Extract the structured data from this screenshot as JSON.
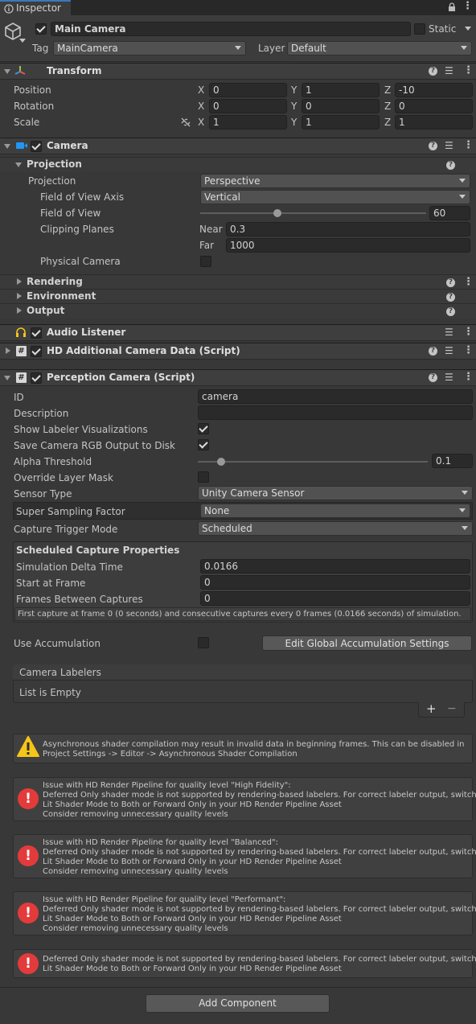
{
  "tab": {
    "title": "Inspector"
  },
  "header": {
    "name": "Main Camera",
    "static_label": "Static",
    "tag_label": "Tag",
    "tag_value": "MainCamera",
    "layer_label": "Layer",
    "layer_value": "Default"
  },
  "transform": {
    "title": "Transform",
    "rows": [
      {
        "label": "Position",
        "x": "0",
        "y": "1",
        "z": "-10"
      },
      {
        "label": "Rotation",
        "x": "0",
        "y": "0",
        "z": "0"
      },
      {
        "label": "Scale",
        "x": "1",
        "y": "1",
        "z": "1"
      }
    ],
    "axis_x": "X",
    "axis_y": "Y",
    "axis_z": "Z"
  },
  "camera": {
    "title": "Camera",
    "projection_section": "Projection",
    "projection_label": "Projection",
    "projection_value": "Perspective",
    "fov_axis_label": "Field of View Axis",
    "fov_axis_value": "Vertical",
    "fov_label": "Field of View",
    "fov_value": "60",
    "fov_fraction": 0.34,
    "clipping_label": "Clipping Planes",
    "near_label": "Near",
    "near_value": "0.3",
    "far_label": "Far",
    "far_value": "1000",
    "physical_label": "Physical Camera",
    "rendering": "Rendering",
    "environment": "Environment",
    "output": "Output"
  },
  "audio_listener": {
    "title": "Audio Listener"
  },
  "hd_additional": {
    "title": "HD Additional Camera Data (Script)"
  },
  "perception": {
    "title": "Perception Camera (Script)",
    "id_label": "ID",
    "id_value": "camera",
    "description_label": "Description",
    "description_value": "",
    "show_labeler_label": "Show Labeler Visualizations",
    "save_rgb_label": "Save Camera RGB Output to Disk",
    "alpha_label": "Alpha Threshold",
    "alpha_value": "0.1",
    "alpha_fraction": 0.1,
    "override_mask_label": "Override Layer Mask",
    "sensor_type_label": "Sensor Type",
    "sensor_type_value": "Unity Camera Sensor",
    "super_sampling_label": "Super Sampling Factor",
    "super_sampling_value": "None",
    "capture_trigger_label": "Capture Trigger Mode",
    "capture_trigger_value": "Scheduled",
    "scheduled_title": "Scheduled Capture Properties",
    "sim_delta_label": "Simulation Delta Time",
    "sim_delta_value": "0.0166",
    "start_frame_label": "Start at Frame",
    "start_frame_value": "0",
    "frames_between_label": "Frames Between Captures",
    "frames_between_value": "0",
    "capture_note": "First capture at frame 0 (0 seconds) and consecutive captures every 0 frames (0.0166 seconds) of simulation.",
    "use_accum_label": "Use Accumulation",
    "edit_accum_button": "Edit Global Accumulation Settings",
    "labelers_title": "Camera Labelers",
    "labelers_empty": "List is Empty",
    "add_glyph": "+",
    "remove_glyph": "−"
  },
  "messages": [
    {
      "type": "warning",
      "lines": [
        "Asynchronous shader compilation may result in invalid data in beginning frames. This can be disabled in",
        "Project Settings -> Editor -> Asynchronous Shader Compilation"
      ]
    },
    {
      "type": "error",
      "lines": [
        "Issue with HD Render Pipeline for quality level \"High Fidelity\":",
        "Deferred Only shader mode is not supported by rendering-based labelers. For correct labeler output, switch",
        "Lit Shader Mode to Both or Forward Only in your HD Render Pipeline Asset",
        "Consider removing unnecessary quality levels"
      ]
    },
    {
      "type": "error",
      "lines": [
        "Issue with HD Render Pipeline for quality level \"Balanced\":",
        "Deferred Only shader mode is not supported by rendering-based labelers. For correct labeler output, switch",
        "Lit Shader Mode to Both or Forward Only in your HD Render Pipeline Asset",
        "Consider removing unnecessary quality levels"
      ]
    },
    {
      "type": "error",
      "lines": [
        "Issue with HD Render Pipeline for quality level \"Performant\":",
        "Deferred Only shader mode is not supported by rendering-based labelers. For correct labeler output, switch",
        "Lit Shader Mode to Both or Forward Only in your HD Render Pipeline Asset",
        "Consider removing unnecessary quality levels"
      ]
    },
    {
      "type": "error",
      "lines": [
        "Deferred Only shader mode is not supported by rendering-based labelers. For correct labeler output, switch",
        "Lit Shader Mode to Both or Forward Only in your HD Render Pipeline Asset"
      ]
    }
  ],
  "add_component_button": "Add Component",
  "colors": {
    "accent": "#3a79bb",
    "panel": "#383838",
    "header": "#3e3e3e",
    "field": "#2a2a2a",
    "error": "#e33b3b",
    "warning": "#f5c518"
  },
  "icons": {
    "lock": "lock-icon",
    "menu": "kebab-menu-icon",
    "help": "help-icon",
    "preset": "preset-sliders-icon",
    "more": "more-dots-icon"
  }
}
